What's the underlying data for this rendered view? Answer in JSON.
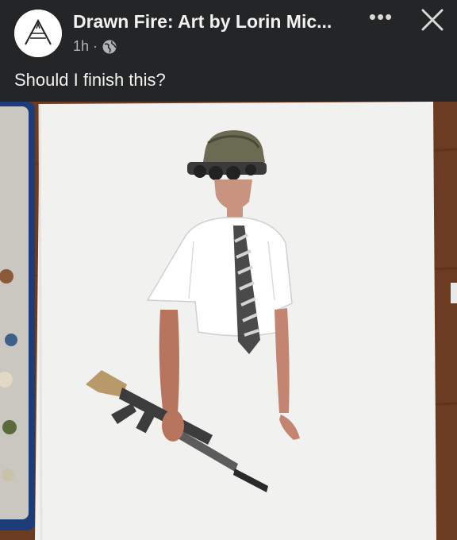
{
  "post": {
    "page_name": "Drawn Fire: Art by Lorin Mic...",
    "time": "1h",
    "separator": "·",
    "privacy_icon": "globe-icon",
    "caption": "Should I finish this?"
  },
  "controls": {
    "more_label": "•••",
    "more_icon": "more-options-icon",
    "close_icon": "close-icon"
  },
  "colors": {
    "background": "#242526",
    "text_primary": "#f2f2f2",
    "text_secondary": "#b0b3b8",
    "table_wood": "#6b3b22",
    "paper": "#f1f1ef"
  }
}
